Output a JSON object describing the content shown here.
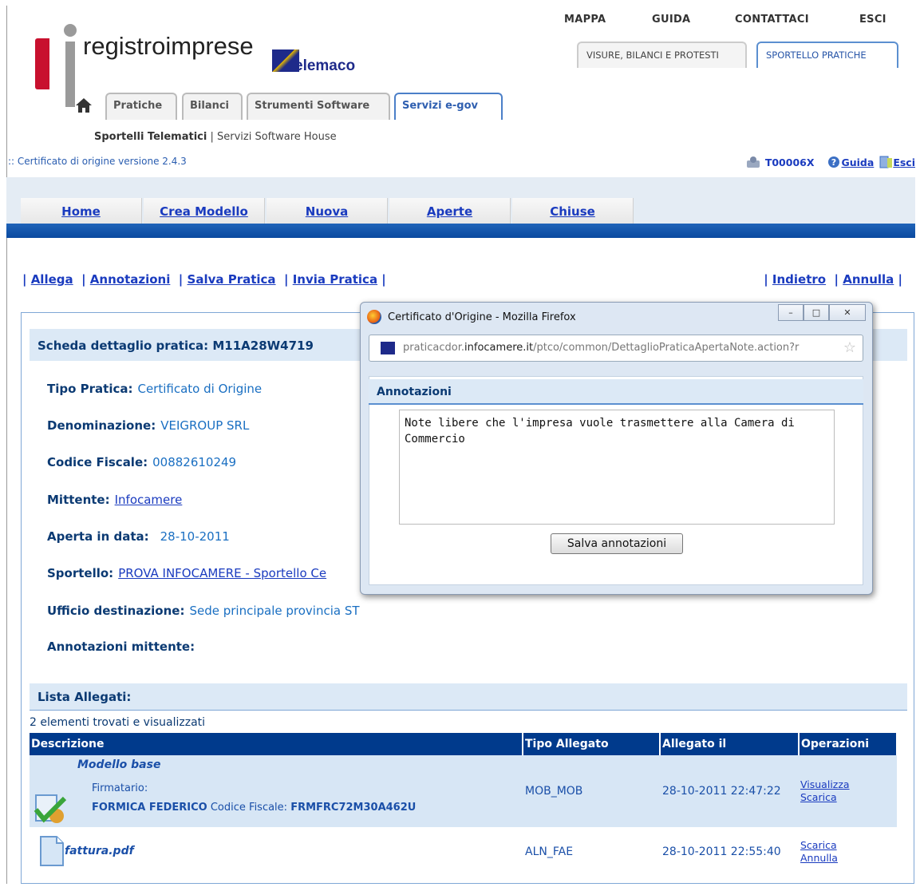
{
  "header": {
    "logo_text": "registroimprese",
    "telemaco": "elemaco",
    "top_links": [
      "MAPPA",
      "GUIDA",
      "CONTATTACI",
      "ESCI"
    ],
    "right_tabs": [
      "VISURE, BILANCI E PROTESTI",
      "SPORTELLO PRATICHE"
    ],
    "left_tabs": [
      "Pratiche",
      "Bilanci",
      "Strumenti Software",
      "Servizi e-gov"
    ],
    "subnav_bold": "Sportelli Telematici",
    "subnav_sep": " | ",
    "subnav_rest": "Servizi Software House",
    "version": ":: Certificato di origine versione 2.4.3",
    "user": "T00006X",
    "guida": "Guida",
    "esci": "Esci"
  },
  "menu": [
    "Home",
    "Crea Modello",
    "Nuova",
    "Aperte",
    "Chiuse"
  ],
  "actions": {
    "left": [
      "Allega",
      "Annotazioni",
      "Salva Pratica",
      "Invia Pratica"
    ],
    "right": [
      "Indietro",
      "Annulla"
    ]
  },
  "detail": {
    "title": "Scheda dettaglio pratica: M11A28W4719",
    "fields": [
      {
        "label": "Tipo Pratica:",
        "value": "Certificato di Origine"
      },
      {
        "label": "Denominazione:",
        "value": "VEIGROUP SRL"
      },
      {
        "label": "Codice Fiscale:",
        "value": "00882610249"
      },
      {
        "label": "Mittente:",
        "value": "Infocamere"
      },
      {
        "label": "Aperta in data:",
        "value": "28-10-2011"
      },
      {
        "label": "Sportello:",
        "value": "PROVA INFOCAMERE - Sportello Ce"
      },
      {
        "label": "Ufficio destinazione:",
        "value": "Sede principale provincia ST"
      },
      {
        "label": "Annotazioni mittente:",
        "value": ""
      }
    ]
  },
  "attachments": {
    "title": "Lista Allegati:",
    "count_text": "2 elementi trovati e visualizzati",
    "columns": [
      "Descrizione",
      "Tipo Allegato",
      "Allegato il",
      "Operazioni"
    ],
    "rows": [
      {
        "name": "Modello base",
        "signer_label": "Firmatario:",
        "signer": "FORMICA FEDERICO",
        "cf_label": "Codice Fiscale:",
        "cf": "FRMFRC72M30A462U",
        "type": "MOB_MOB",
        "date": "28-10-2011 22:47:22",
        "ops": [
          "Visualizza",
          "Scarica"
        ]
      },
      {
        "name": "fattura.pdf",
        "type": "ALN_FAE",
        "date": "28-10-2011 22:55:40",
        "ops": [
          "Scarica",
          "Annulla"
        ]
      }
    ]
  },
  "popup": {
    "title": "Certificato d'Origine - Mozilla Firefox",
    "url_pre": "praticacdor.",
    "url_domain": "infocamere.it",
    "url_post": "/ptco/common/DettaglioPraticaApertaNote.action?r",
    "section": "Annotazioni",
    "note": "Note libere che l'impresa vuole trasmettere alla Camera di Commercio",
    "save_button": "Salva annotazioni"
  },
  "colors": {
    "accent": "#003a8c",
    "panel_header": "#dce9f6",
    "logo_red": "#c8102e",
    "link": "#1a3bbf"
  }
}
